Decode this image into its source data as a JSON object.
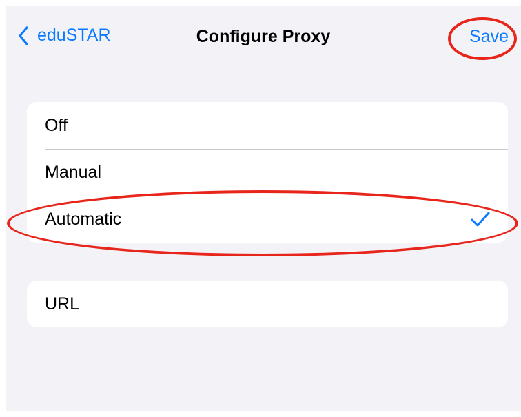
{
  "navbar": {
    "back_label": "eduSTAR",
    "title": "Configure Proxy",
    "save_label": "Save"
  },
  "proxy_modes": [
    {
      "label": "Off",
      "selected": false
    },
    {
      "label": "Manual",
      "selected": false
    },
    {
      "label": "Automatic",
      "selected": true
    }
  ],
  "url_row": {
    "label": "URL"
  },
  "icons": {
    "back": "chevron-left-icon",
    "selected": "checkmark-icon"
  },
  "colors": {
    "accent": "#0a7aff",
    "background": "#f2f2f7",
    "annotation": "#e8251b"
  }
}
